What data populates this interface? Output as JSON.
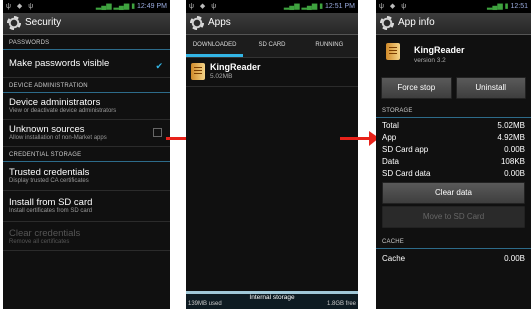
{
  "colors": {
    "accent": "#33b5e5",
    "arrow": "#e8221a"
  },
  "screen1": {
    "status": {
      "time": "12:49"
    },
    "title": "Security",
    "sections": [
      {
        "header": "PASSWORDS"
      },
      {
        "header": "DEVICE ADMINISTRATION"
      },
      {
        "header": "CREDENTIAL STORAGE"
      }
    ],
    "items": [
      {
        "title": "Make passwords visible",
        "subtitle": "",
        "checked": true
      },
      {
        "title": "Device administrators",
        "subtitle": "View or deactivate device administrators"
      },
      {
        "title": "Unknown sources",
        "subtitle": "Allow installation of non-Market apps",
        "checked": false
      },
      {
        "title": "Trusted credentials",
        "subtitle": "Display trusted CA certificates"
      },
      {
        "title": "Install from SD card",
        "subtitle": "Install certificates from SD card"
      },
      {
        "title": "Clear credentials",
        "subtitle": "Remove all certificates",
        "disabled": true
      }
    ]
  },
  "screen2": {
    "status": {
      "time": "12:51"
    },
    "title": "Apps",
    "tabs": [
      "DOWNLOADED",
      "SD CARD",
      "RUNNING"
    ],
    "apps": [
      {
        "name": "KingReader",
        "size": "5.02MB"
      }
    ],
    "storage": {
      "label": "Internal storage",
      "used": "139MB used",
      "free": "1.8GB free"
    }
  },
  "screen3": {
    "status": {
      "time": "12:51"
    },
    "title": "App info",
    "app": {
      "name": "KingReader",
      "version": "version 3.2"
    },
    "buttons": {
      "force_stop": "Force stop",
      "uninstall": "Uninstall",
      "clear_data": "Clear data",
      "move_to_sd": "Move to SD Card"
    },
    "storage_header": "STORAGE",
    "storage_rows": [
      {
        "label": "Total",
        "value": "5.02MB"
      },
      {
        "label": "App",
        "value": "4.92MB"
      },
      {
        "label": "SD Card app",
        "value": "0.00B"
      },
      {
        "label": "Data",
        "value": "108KB"
      },
      {
        "label": "SD Card data",
        "value": "0.00B"
      }
    ],
    "cache_header": "CACHE",
    "cache_row": {
      "label": "Cache",
      "value": "0.00B"
    }
  }
}
